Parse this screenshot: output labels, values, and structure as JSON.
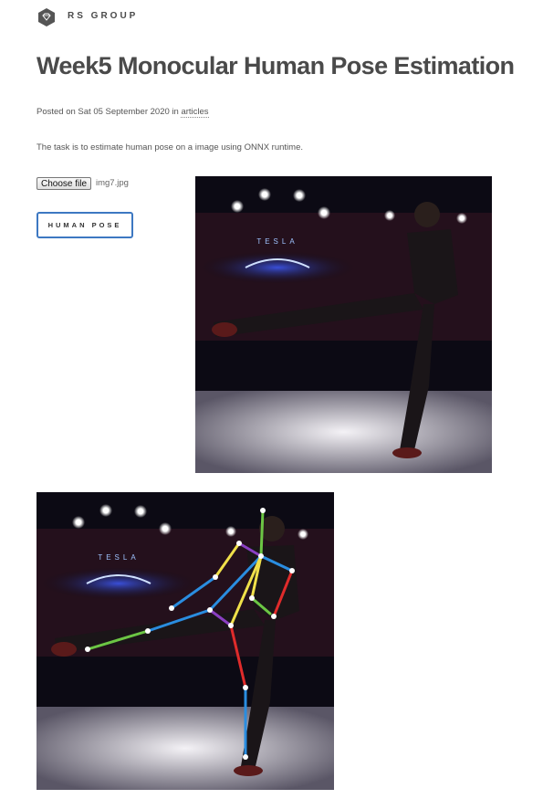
{
  "brand": {
    "name": "RS GROUP",
    "icon": "diamond-hexagon-icon"
  },
  "post": {
    "title": "Week5 Monocular Human Pose Estimation",
    "posted_prefix": "Posted on Sat 05 September 2020 in",
    "category": "articles",
    "description": "The task is to estimate human pose on a image using ONNX runtime."
  },
  "upload": {
    "choose_label": "Choose file",
    "file_name": "img7.jpg"
  },
  "actions": {
    "pose_button": "HUMAN POSE"
  },
  "images": {
    "input_screen_text": "TESLA",
    "output_screen_text": "TESLA"
  },
  "colors": {
    "accent_border": "#3d78c2",
    "text_dark": "#4a4a4a",
    "skeleton_green": "#6cc644",
    "skeleton_yellow": "#f0e04a",
    "skeleton_blue": "#2a8de0",
    "skeleton_red": "#e02b2b",
    "skeleton_purple": "#8a3fc2"
  }
}
